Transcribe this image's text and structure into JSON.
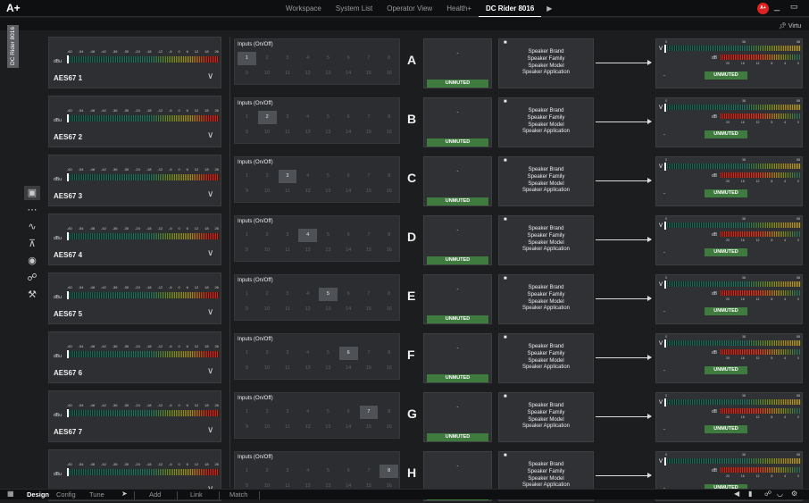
{
  "app": {
    "logo": "A+"
  },
  "nav": {
    "items": [
      "Workspace",
      "System List",
      "Operator View",
      "Health+",
      "DC Rider 8016"
    ],
    "active_index": 4,
    "brand_badge": "A+"
  },
  "window": {
    "minimize": "_",
    "restore": "▭"
  },
  "virtual_label": "Virtu",
  "device_tab": "DC Rider 8016",
  "meter": {
    "scale": [
      "-60",
      "-54",
      "-48",
      "-42",
      "-36",
      "-30",
      "-24",
      "-18",
      "-12",
      "-6",
      "0",
      "6",
      "12",
      "18",
      "26"
    ],
    "unit": "dBu"
  },
  "output_meter": {
    "unit_v": "V",
    "scale_top": [
      "0",
      "38",
      "58"
    ],
    "unit_db": "dB",
    "gr_scale": [
      "20",
      "16",
      "12",
      "8",
      "4",
      "0"
    ]
  },
  "inputs_title": "Inputs (On/Off)",
  "input_numbers": [
    "1",
    "2",
    "3",
    "4",
    "5",
    "6",
    "7",
    "8",
    "9",
    "10",
    "11",
    "12",
    "13",
    "14",
    "15",
    "16"
  ],
  "mute_status": "UNMUTED",
  "dash": "-",
  "speaker_labels": [
    "Speaker Brand",
    "Speaker Family",
    "Speaker Model",
    "Speaker Application"
  ],
  "channels": [
    {
      "aes": "AES67 1",
      "letter": "A",
      "active": 1
    },
    {
      "aes": "AES67 2",
      "letter": "B",
      "active": 2
    },
    {
      "aes": "AES67 3",
      "letter": "C",
      "active": 3
    },
    {
      "aes": "AES67 4",
      "letter": "D",
      "active": 4
    },
    {
      "aes": "AES67 5",
      "letter": "E",
      "active": 5
    },
    {
      "aes": "AES67 6",
      "letter": "F",
      "active": 6
    },
    {
      "aes": "AES67 7",
      "letter": "G",
      "active": 7
    },
    {
      "aes": "",
      "letter": "H",
      "active": 8
    }
  ],
  "bottom": {
    "tabs": [
      "Design",
      "Config",
      "Tune"
    ],
    "active_tab": "Design",
    "actions": [
      "Add",
      "Link",
      "Match"
    ]
  }
}
